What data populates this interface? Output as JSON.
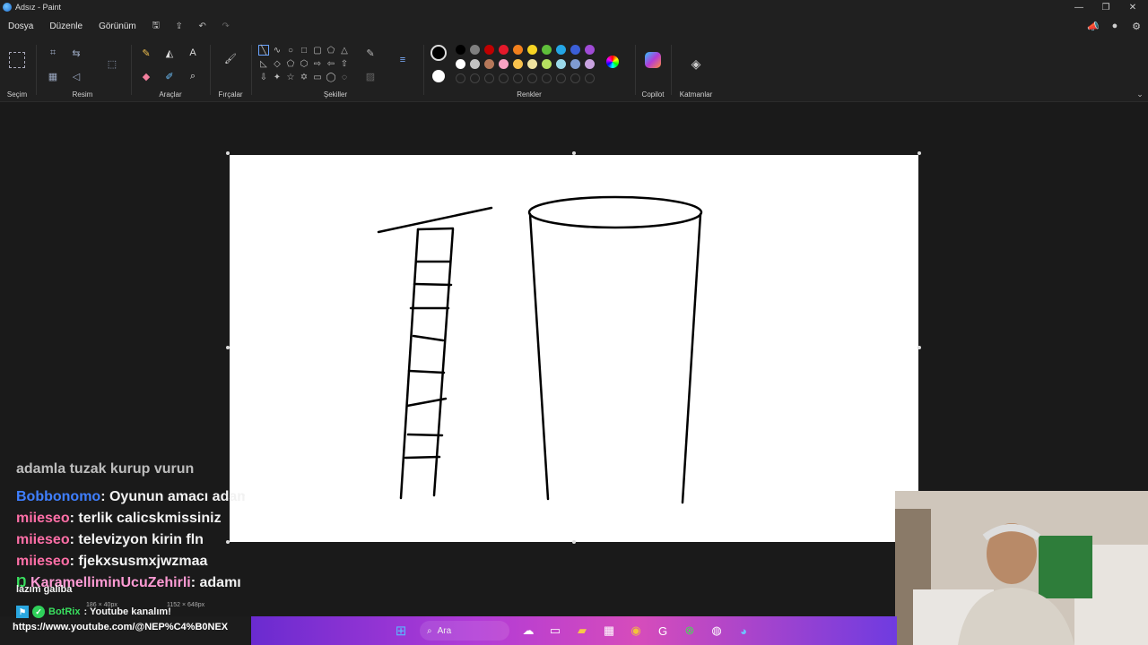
{
  "window": {
    "title": "Adsız - Paint",
    "controls": {
      "minimize": "—",
      "maximize": "❐",
      "close": "✕"
    }
  },
  "menu": {
    "items": [
      "Dosya",
      "Düzenle",
      "Görünüm"
    ],
    "quick_access": {
      "save": "🖫",
      "share": "⇪",
      "undo": "↶",
      "redo": "↷"
    }
  },
  "ribbon": {
    "groups": {
      "selection": "Seçim",
      "image": "Resim",
      "tools": "Araçlar",
      "brushes": "Fırçalar",
      "shapes": "Şekiller",
      "colors": "Renkler",
      "copilot": "Copilot",
      "layers": "Katmanlar"
    },
    "palette": [
      "#000000",
      "#7f7f7f",
      "#c00000",
      "#e5192b",
      "#f2801d",
      "#f7d423",
      "#5fbf3a",
      "#24a6e6",
      "#3b5fd8",
      "#a04bd6",
      "#ffffff",
      "#c3c3c3",
      "#b6785a",
      "#f9a3c4",
      "#f8c24d",
      "#efe3a0",
      "#b5e061",
      "#9ad9ea",
      "#7f9bd1",
      "#c9a3e0"
    ],
    "primary_color": "#000000",
    "secondary_color": "#ffffff"
  },
  "status": {
    "selection_size": "186 × 40px",
    "canvas_size": "1152 × 648px"
  },
  "chat": {
    "messages": [
      {
        "user": "",
        "text": "adamla tuzak kurup vurun",
        "color": "#f2f2f2"
      },
      {
        "user": "Bobbonomo",
        "text": ": Oyunun amacı adamı öldürmek",
        "color": "#3f7fff"
      },
      {
        "user": "miieseo",
        "text": ": terlik calicskmissiniz",
        "color": "#ff6fa7"
      },
      {
        "user": "miieseo",
        "text": ": televizyon kirin fln",
        "color": "#ff6fa7"
      },
      {
        "user": "miieseo",
        "text": ": fjekxsusmxjwzmaa",
        "color": "#ff6fa7"
      },
      {
        "user": "KaramelliminUcuZehirli",
        "text": ": adamı kudurtmanız",
        "color": "#ff9bd4"
      }
    ],
    "continuation": "lazım galiba",
    "bot": {
      "user": "BotRix",
      "text": ": Youtube kanalım!",
      "color": "#39e05f"
    },
    "link": "https://www.youtube.com/@NEP%C4%B0NEX"
  },
  "taskbar": {
    "search_placeholder": "Ara"
  }
}
